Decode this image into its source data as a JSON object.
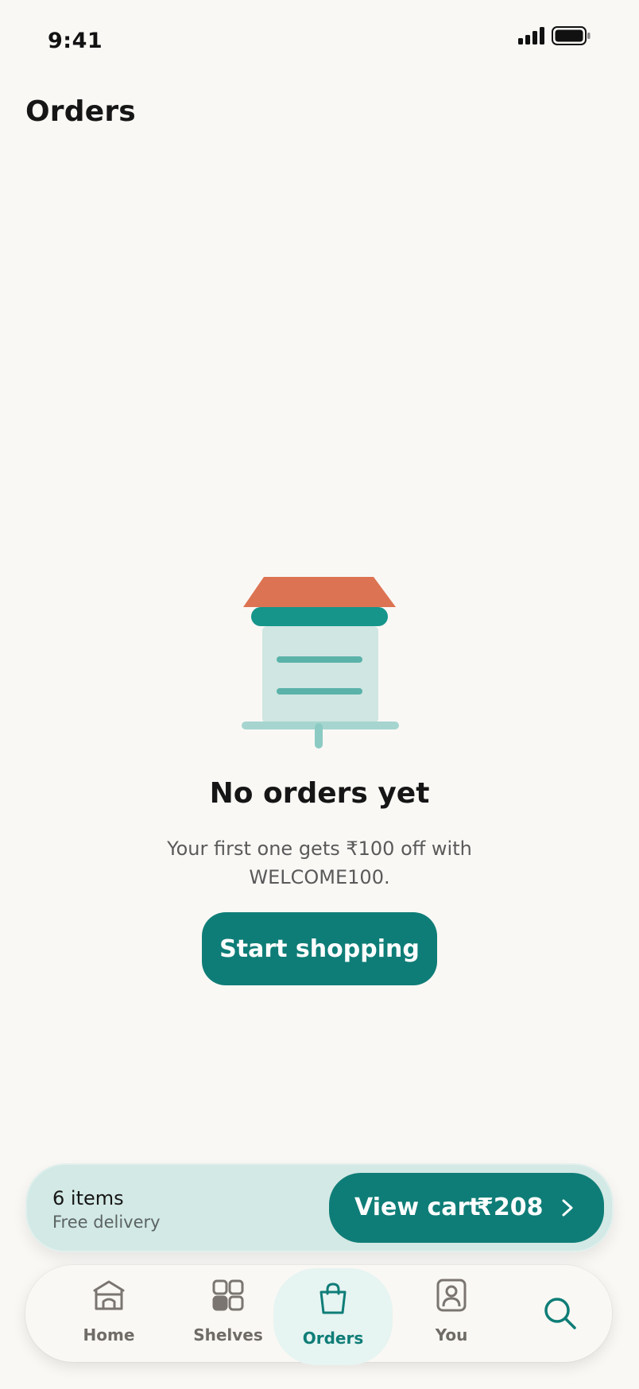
{
  "status_bar": {
    "time": "9:41"
  },
  "header": {
    "title": "Orders"
  },
  "empty_state": {
    "title": "No orders yet",
    "subtitle": "Your first one gets ₹100 off with WELCOME100.",
    "button_label": "Start shopping",
    "illustration": "store-icon"
  },
  "cart_bar": {
    "item_count": "6 items",
    "delivery_note": "Free delivery",
    "button_label": "View cart",
    "total": "₹208"
  },
  "tab_bar": {
    "tabs": [
      {
        "label": "Home",
        "icon": "home-icon",
        "active": false
      },
      {
        "label": "Shelves",
        "icon": "grid-icon",
        "active": false
      },
      {
        "label": "Orders",
        "icon": "bag-icon",
        "active": true
      },
      {
        "label": "You",
        "icon": "profile-icon",
        "active": false
      }
    ],
    "search_icon": "search-icon"
  },
  "colors": {
    "accent": "#0f7d77",
    "background": "#faf8f5",
    "roof": "#dc7352",
    "cart_bar_bg": "#d3e9e5",
    "active_tab_bg": "#e6f4f2"
  }
}
